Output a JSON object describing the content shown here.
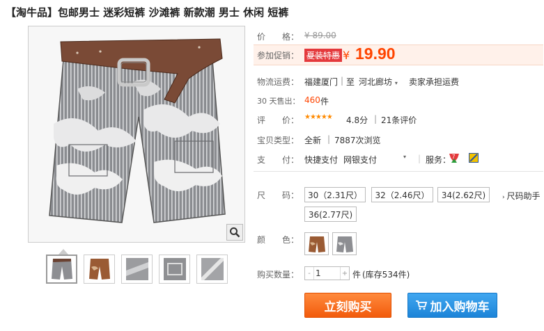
{
  "product": {
    "title": "【淘牛品】包邮男士 迷彩短裤 沙滩裤 新款潮 男士 休闲 短裤"
  },
  "price": {
    "label": "价　　格：",
    "original": "¥ 89.00"
  },
  "promo": {
    "label": "参加促销：",
    "badge": "夏装特惠",
    "currency": "¥",
    "value": "19.90"
  },
  "shipping": {
    "label": "物流运费：",
    "from": "福建厦门",
    "to_prefix": "至",
    "to": "河北廊坊",
    "note": "卖家承担运费"
  },
  "sales": {
    "label": "30 天售出：",
    "count": "460",
    "unit": "件"
  },
  "rating": {
    "label": "评　　价：",
    "stars": "★★★★★",
    "score": "4.8分",
    "reviews": "21条评价",
    "star_color": "#ff8a00"
  },
  "type": {
    "label": "宝贝类型：",
    "value": "全新",
    "views": "7887次浏览"
  },
  "payment": {
    "label": "支　　付：",
    "method1": "快捷支付",
    "method2": "网银支付",
    "service_label": "服务："
  },
  "size": {
    "label": "尺　　码：",
    "options": [
      "30（2.31尺）",
      "32（2.46尺）",
      "34(2.62尺)",
      "36(2.77尺)"
    ],
    "helper": "尺码助手"
  },
  "color": {
    "label": "颜　　色："
  },
  "quantity": {
    "label": "购买数量：",
    "minus": "-",
    "plus": "+",
    "value": "1",
    "unit": "件",
    "stock": "(库存534件)"
  },
  "actions": {
    "buy": "立刻购买",
    "cart": "加入购物车"
  },
  "colors": {
    "accent": "#ff4400",
    "buy_button": "#f25b0c",
    "cart_button": "#1c84d8"
  }
}
